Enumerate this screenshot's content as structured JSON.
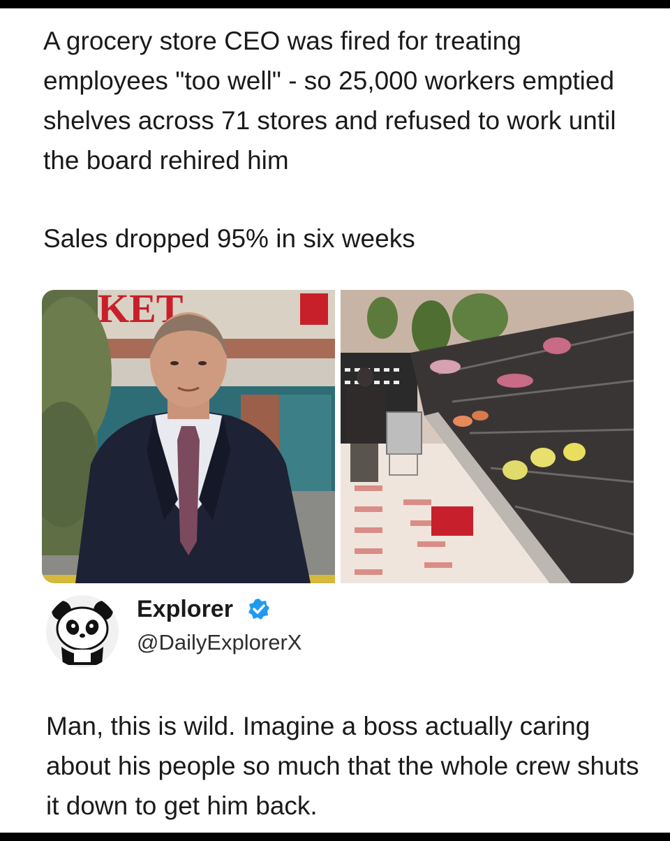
{
  "post": {
    "headline": "A grocery store CEO was fired for treating employees \"too well\" - so 25,000 workers emptied shelves across 71 stores and refused to work until the board rehired him",
    "subline": "Sales dropped 95% in six weeks"
  },
  "media": {
    "left_photo": {
      "sign_text": "KET"
    },
    "right_photo": {}
  },
  "author": {
    "name": "Explorer",
    "handle": "@DailyExplorerX",
    "verified": true,
    "avatar_icon": "panda-icon",
    "verified_icon": "verified-badge-icon"
  },
  "reply": {
    "text": "Man, this is wild. Imagine a boss actually caring about his people so much that the whole crew shuts it down to get him back."
  },
  "colors": {
    "verified_blue": "#1d9bf0",
    "sign_red": "#c8202a"
  }
}
